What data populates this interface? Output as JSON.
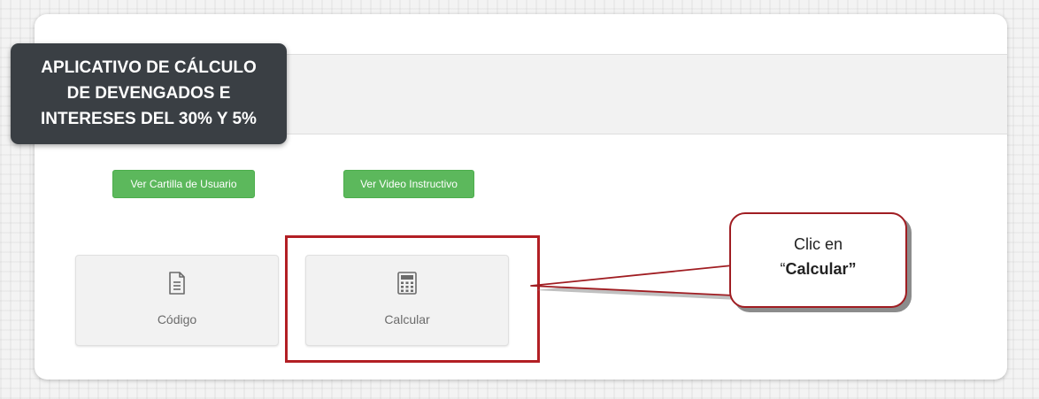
{
  "app": {
    "title_lines": [
      "APLICATIVO DE CÁLCULO",
      "DE DEVENGADOS E",
      "INTERESES DEL 30% Y 5%"
    ]
  },
  "buttons": {
    "cartilla_label": "Ver Cartilla de Usuario",
    "video_label": "Ver Video Instructivo"
  },
  "tiles": [
    {
      "label": "Código",
      "icon": "document-icon"
    },
    {
      "label": "Calcular",
      "icon": "calculator-icon"
    }
  ],
  "callout": {
    "line1": "Clic en",
    "open_quote": "“",
    "target": "Calcular”"
  },
  "colors": {
    "badge": "#3a3f44",
    "green_button": "#5cb85c",
    "highlight": "#b21f24"
  }
}
